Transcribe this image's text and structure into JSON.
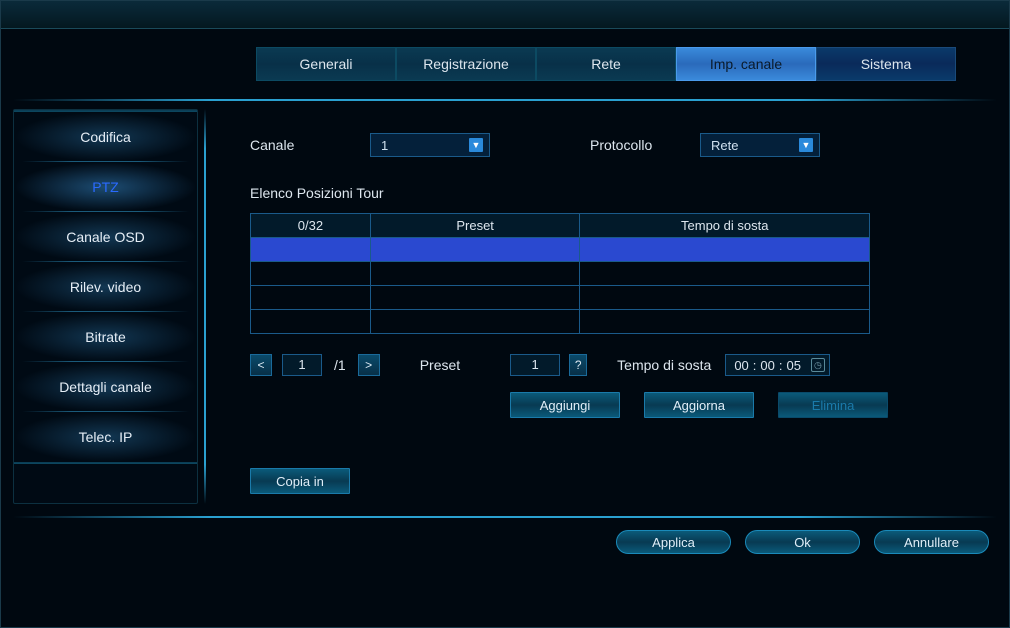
{
  "tabs": {
    "generali": "Generali",
    "registrazione": "Registrazione",
    "rete": "Rete",
    "imp_canale": "Imp. canale",
    "sistema": "Sistema"
  },
  "sidebar": {
    "codifica": "Codifica",
    "ptz": "PTZ",
    "canale_osd": "Canale OSD",
    "rilev_video": "Rilev. video",
    "bitrate": "Bitrate",
    "dettagli_canale": "Dettagli canale",
    "telec_ip": "Telec. IP"
  },
  "form": {
    "canale_label": "Canale",
    "canale_value": "1",
    "protocollo_label": "Protocollo",
    "protocollo_value": "Rete",
    "section_title": "Elenco Posizioni Tour"
  },
  "tour_table": {
    "header_count": "0/32",
    "header_preset": "Preset",
    "header_time": "Tempo di sosta",
    "rows": [
      {
        "n": "",
        "preset": "",
        "time": ""
      },
      {
        "n": "",
        "preset": "",
        "time": ""
      },
      {
        "n": "",
        "preset": "",
        "time": ""
      },
      {
        "n": "",
        "preset": "",
        "time": ""
      }
    ]
  },
  "pager": {
    "page": "1",
    "total": "/1",
    "preset_label": "Preset",
    "preset_value": "1",
    "time_label": "Tempo di sosta",
    "time_value_h": "00",
    "time_value_m": "00",
    "time_value_s": "05"
  },
  "buttons": {
    "aggiungi": "Aggiungi",
    "aggiorna": "Aggiorna",
    "elimina": "Elimina",
    "copia_in": "Copia in"
  },
  "footer": {
    "applica": "Applica",
    "ok": "Ok",
    "annullare": "Annullare"
  }
}
